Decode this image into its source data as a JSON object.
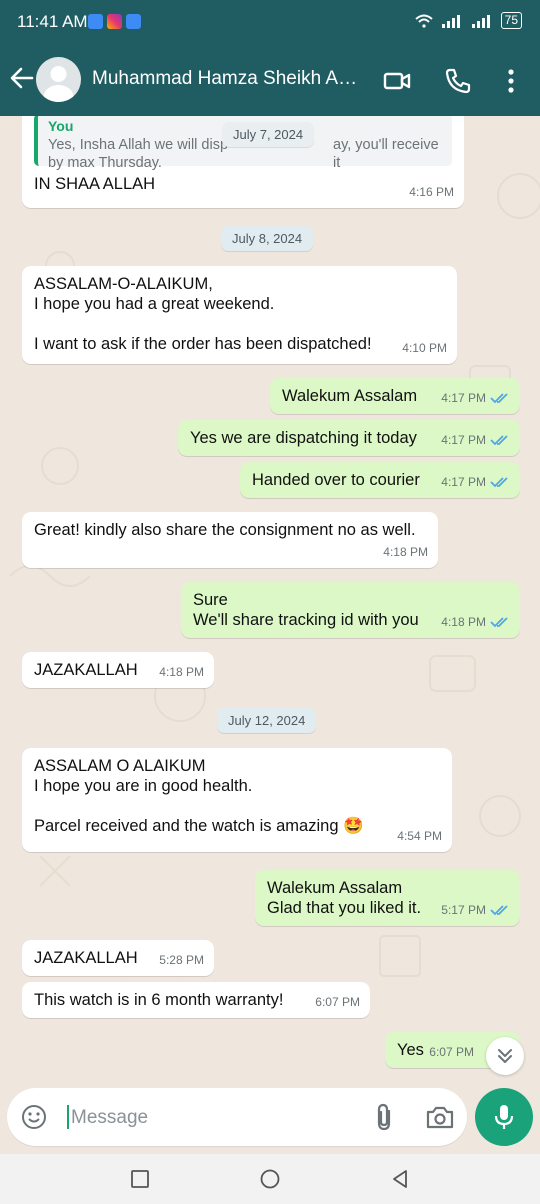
{
  "status_bar": {
    "time": "11:41 AM",
    "battery": "75"
  },
  "header": {
    "contact_name": "Muhammad Hamza Sheikh Am..."
  },
  "chat": {
    "first": {
      "quote_author": "You",
      "quote_text": "Yes, Insha Allah we will disp",
      "quote_text_2": "ay, you'll receive it",
      "quote_text_3": "by max Thursday.",
      "floating_date": "July 7, 2024",
      "text": "IN SHAA ALLAH",
      "time": "4:16 PM"
    },
    "date_1": "July 8, 2024",
    "m1": {
      "text": "ASSALAM-O-ALAIKUM,\nI hope you had a great weekend.\n\nI want to ask if the order has been dispatched!",
      "time": "4:10 PM"
    },
    "m2": {
      "text": "Walekum Assalam",
      "time": "4:17 PM"
    },
    "m3": {
      "text": "Yes we are dispatching it today",
      "time": "4:17 PM"
    },
    "m4": {
      "text": "Handed over to courier",
      "time": "4:17 PM"
    },
    "m5": {
      "text": "Great! kindly also share the consignment no as well.",
      "time": "4:18 PM"
    },
    "m6": {
      "text": "Sure\nWe'll share tracking id with you",
      "time": "4:18 PM"
    },
    "m7": {
      "text": "JAZAKALLAH",
      "time": "4:18 PM"
    },
    "date_2": "July 12, 2024",
    "m8": {
      "text": "ASSALAM O ALAIKUM\nI hope you are in good health.\n\nParcel received and the watch is amazing",
      "emoji": "🤩",
      "time": "4:54 PM"
    },
    "m9": {
      "text": "Walekum Assalam\nGlad that you liked it.",
      "time": "5:17 PM"
    },
    "m10": {
      "text": "JAZAKALLAH",
      "time": "5:28 PM"
    },
    "m11": {
      "text": "This watch is in 6 month warranty!",
      "time": "6:07 PM"
    },
    "m12": {
      "text": "Yes",
      "time": "6:07 PM"
    }
  },
  "input": {
    "placeholder": "Message"
  },
  "colors": {
    "header": "#1f5d63",
    "outgoing": "#dbf8c6",
    "incoming": "#ffffff",
    "accent": "#1aa37a",
    "tick_read": "#53a6e6"
  }
}
